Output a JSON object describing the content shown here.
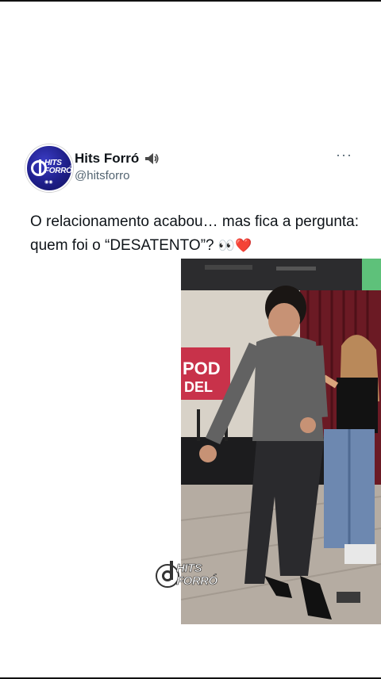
{
  "post": {
    "author": {
      "display_name": "Hits Forró",
      "handle": "@hitsforro",
      "badge_icon": "speaker-icon",
      "avatar_logo_text": "HITS FORRÓ"
    },
    "more_label": "···",
    "text": "O relacionamento acabou… mas fica a pergunta: quem foi o “DESATENTO”?",
    "text_emojis": "👀❤️",
    "media": {
      "type": "video-still",
      "background_sign_text": "POD DEL",
      "watermark_text_line1": "HITS",
      "watermark_text_line2": "FORRÓ"
    }
  },
  "colors": {
    "text": "#0f1419",
    "secondary_text": "#536471",
    "avatar_blue": "#1f1f8a",
    "sign_red": "#c8324a"
  }
}
